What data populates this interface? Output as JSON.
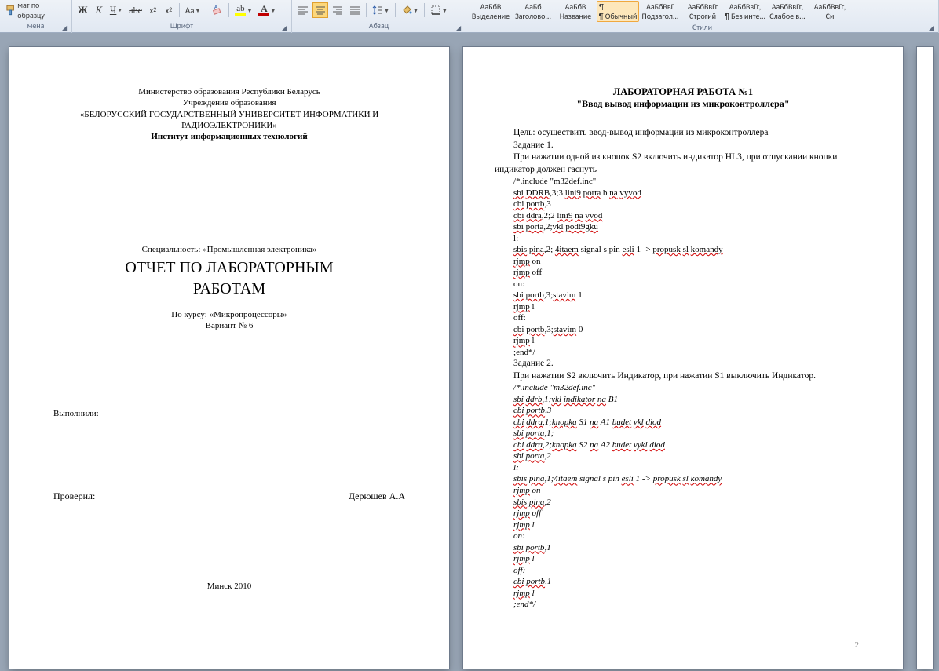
{
  "ribbon": {
    "clipboard": {
      "format_painter": "мат по образцу",
      "label": "мена"
    },
    "font": {
      "bold": "Ж",
      "italic": "К",
      "underline": "Ч",
      "strike": "abc",
      "subscript": "x₂",
      "superscript": "x²",
      "case": "Aa",
      "highlight_letter": "ab",
      "fontcolor_letter": "A",
      "group_label": "Шрифт"
    },
    "paragraph": {
      "group_label": "Абзац"
    },
    "styles": {
      "items": [
        {
          "preview": "АаБбВ",
          "name": "Выделение"
        },
        {
          "preview": "АаБб",
          "name": "Заголово..."
        },
        {
          "preview": "АаБбВ",
          "name": "Название"
        },
        {
          "preview": "¶ Обычный",
          "name": "¶ Обычный",
          "selected": true
        },
        {
          "preview": "АаБбВвГ",
          "name": "Подзагол..."
        },
        {
          "preview": "АаБбВвГг",
          "name": "Строгий"
        },
        {
          "preview": "АаБбВвГг,",
          "name": "¶ Без инте..."
        },
        {
          "preview": "АаБбВвГг,",
          "name": "Слабое в..."
        },
        {
          "preview": "АаБбВвГг,",
          "name": "Си"
        }
      ],
      "group_label": "Стили"
    }
  },
  "page1": {
    "l1": "Министерство образования Республики Беларусь",
    "l2": "Учреждение образования",
    "l3": "«БЕЛОРУССКИЙ  ГОСУДАРСТВЕННЫЙ  УНИВЕРСИТЕТ ИНФОРМАТИКИ И",
    "l4": "РАДИОЭЛЕКТРОНИКИ»",
    "l5": "Институт информационных технологий",
    "spec": "Специальность: «Промышленная электроника»",
    "title1": "ОТЧЕТ ПО ЛАБОРАТОРНЫМ",
    "title2": "РАБОТАМ",
    "course": "По курсу: «Микропроцессоры»",
    "variant": "Вариант № 6",
    "performed": "Выполнили:",
    "checked": "Проверил:",
    "checker": "Дерюшев А.А",
    "footer": "Минск 2010"
  },
  "page2": {
    "title": "ЛАБОРАТОРНАЯ РАБОТА №1",
    "subtitle": "\"Ввод вывод информации из микроконтроллера\"",
    "goal": "Цель: осуществить ввод-вывод информации из микроконтроллера",
    "task1": "Задание 1.",
    "task1_desc": "При нажатии одной из кнопок S2 включить индикатор HL3, при отпускании кнопки индикатор должен гаснуть",
    "code1": [
      "/*.include \"m32def.inc\"",
      "sbi DDRB,3;3 lini9 porta b na vyvod",
      "cbi portb,3",
      "cbi ddra,2;2 lini9 na vvod",
      "sbi porta,2;vkl podt9gku",
      "l:",
      "sbis pina,2; 4itaem signal s pin esli 1 -> propusk sl komandy",
      "rjmp on",
      "rjmp off",
      "on:",
      "sbi portb,3;stavim 1",
      "rjmp l",
      "off:",
      "cbi portb,3;stavim 0",
      "rjmp l",
      ";end*/"
    ],
    "task2": "Задание 2.",
    "task2_desc": "При  нажатии  S2  включить  Индикатор,  при  нажатии  S1  выключить Индикатор.",
    "code2": [
      "/*.include \"m32def.inc\"",
      "sbi ddrb,1;vkl indikator na B1",
      "cbi portb,3",
      "cbi ddra,1;knopka S1 na A1 budet vkl diod",
      "sbi porta,1;",
      "cbi ddra,2;knopka S2 na A2 budet vykl diod",
      "sbi porta,2",
      "l:",
      "sbis pina,1;4itaem signal s pin esli 1 -> propusk sl komandy",
      "rjmp on",
      "sbis pina,2",
      "rjmp off",
      "rjmp l",
      "on:",
      "sbi portb,1",
      "rjmp l",
      "off:",
      "cbi portb,1",
      "rjmp l",
      ";end*/"
    ],
    "page_number": "2"
  }
}
